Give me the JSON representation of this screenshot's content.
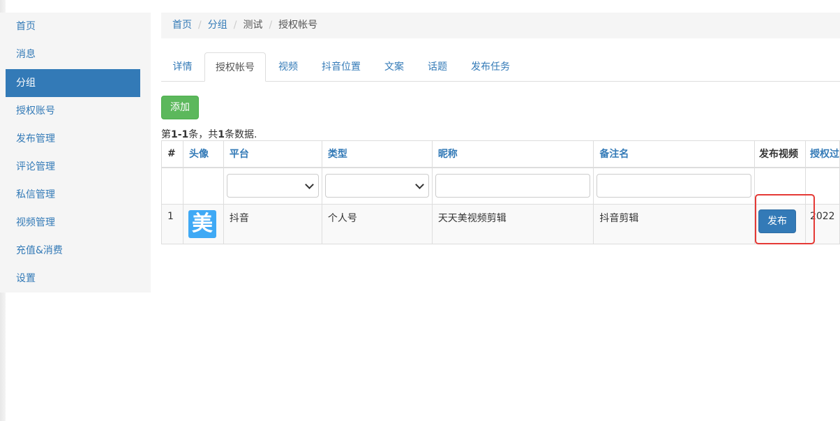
{
  "sidebar": {
    "items": [
      {
        "label": "首页"
      },
      {
        "label": "消息"
      },
      {
        "label": "分组",
        "active": true
      },
      {
        "label": "授权账号"
      },
      {
        "label": "发布管理"
      },
      {
        "label": "评论管理"
      },
      {
        "label": "私信管理"
      },
      {
        "label": "视频管理"
      },
      {
        "label": "充值&消费"
      },
      {
        "label": "设置"
      }
    ]
  },
  "breadcrumb": {
    "items": [
      "首页",
      "分组",
      "测试",
      "授权帐号"
    ],
    "separator": "/"
  },
  "tabs": [
    "详情",
    "授权帐号",
    "视频",
    "抖音位置",
    "文案",
    "话题",
    "发布任务"
  ],
  "active_tab": "授权帐号",
  "toolbar": {
    "add_label": "添加"
  },
  "summary": {
    "prefix": "第",
    "range": "1-1",
    "middle": "条，共",
    "total": "1",
    "suffix": "条数据."
  },
  "table": {
    "headers": [
      "#",
      "头像",
      "平台",
      "类型",
      "昵称",
      "备注名",
      "发布视频",
      "授权过"
    ],
    "rows": [
      {
        "index": "1",
        "avatar_glyph": "美",
        "platform": "抖音",
        "type": "个人号",
        "nickname": "天天美视频剪辑",
        "remark": "抖音剪辑",
        "publish_label": "发布",
        "auth_time": "2022"
      }
    ]
  },
  "colors": {
    "primary": "#337ab7",
    "success": "#5cb85c",
    "highlight": "#e53935",
    "avatar_bg": "#3fa9f5"
  }
}
